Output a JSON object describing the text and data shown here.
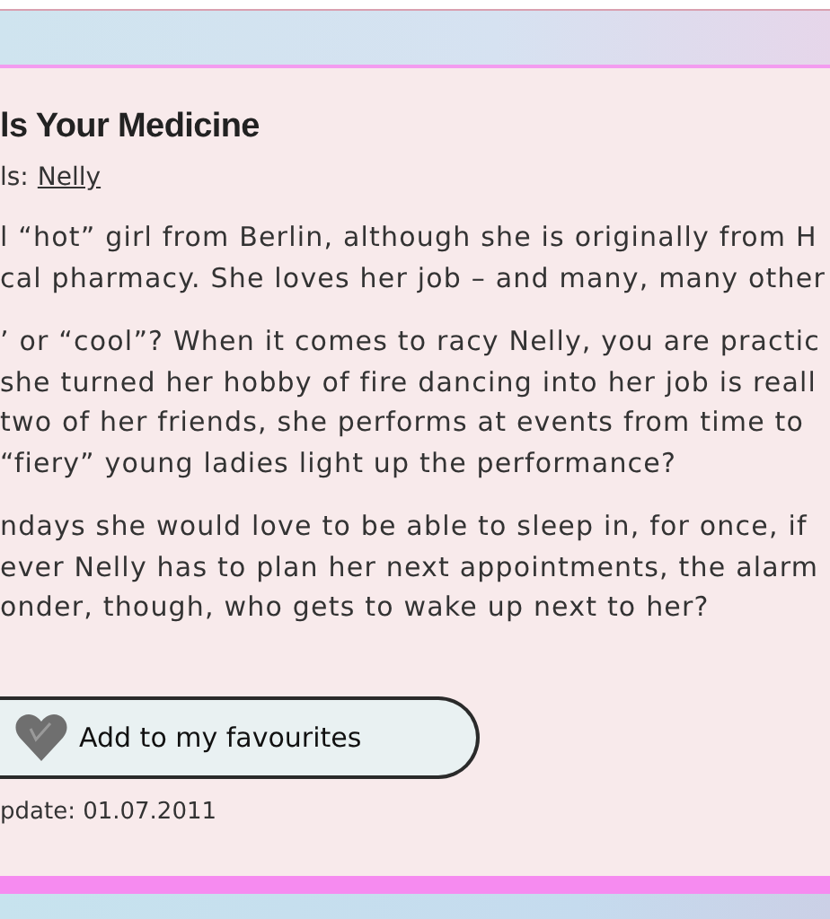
{
  "title": "ls Your Medicine",
  "details": {
    "label": "ls:",
    "link": "Nelly"
  },
  "paragraphs": [
    [
      "l “hot” girl from Berlin, although she is originally from H",
      "cal pharmacy. She loves her job – and many, many other"
    ],
    [
      "’ or “cool”? When it comes to racy Nelly, you are practic",
      "she turned her hobby of fire dancing into her job is reall",
      "two of her friends, she performs at events from time to",
      "“fiery” young ladies light up the performance?"
    ],
    [
      "ndays she would love to be able to sleep in, for once, if",
      "ever Nelly has to plan her next appointments, the alarm",
      "onder, though, who gets to wake up next to her?"
    ]
  ],
  "favourite_button": {
    "label": "Add to my favourites"
  },
  "update": "pdate: 01.07.2011"
}
